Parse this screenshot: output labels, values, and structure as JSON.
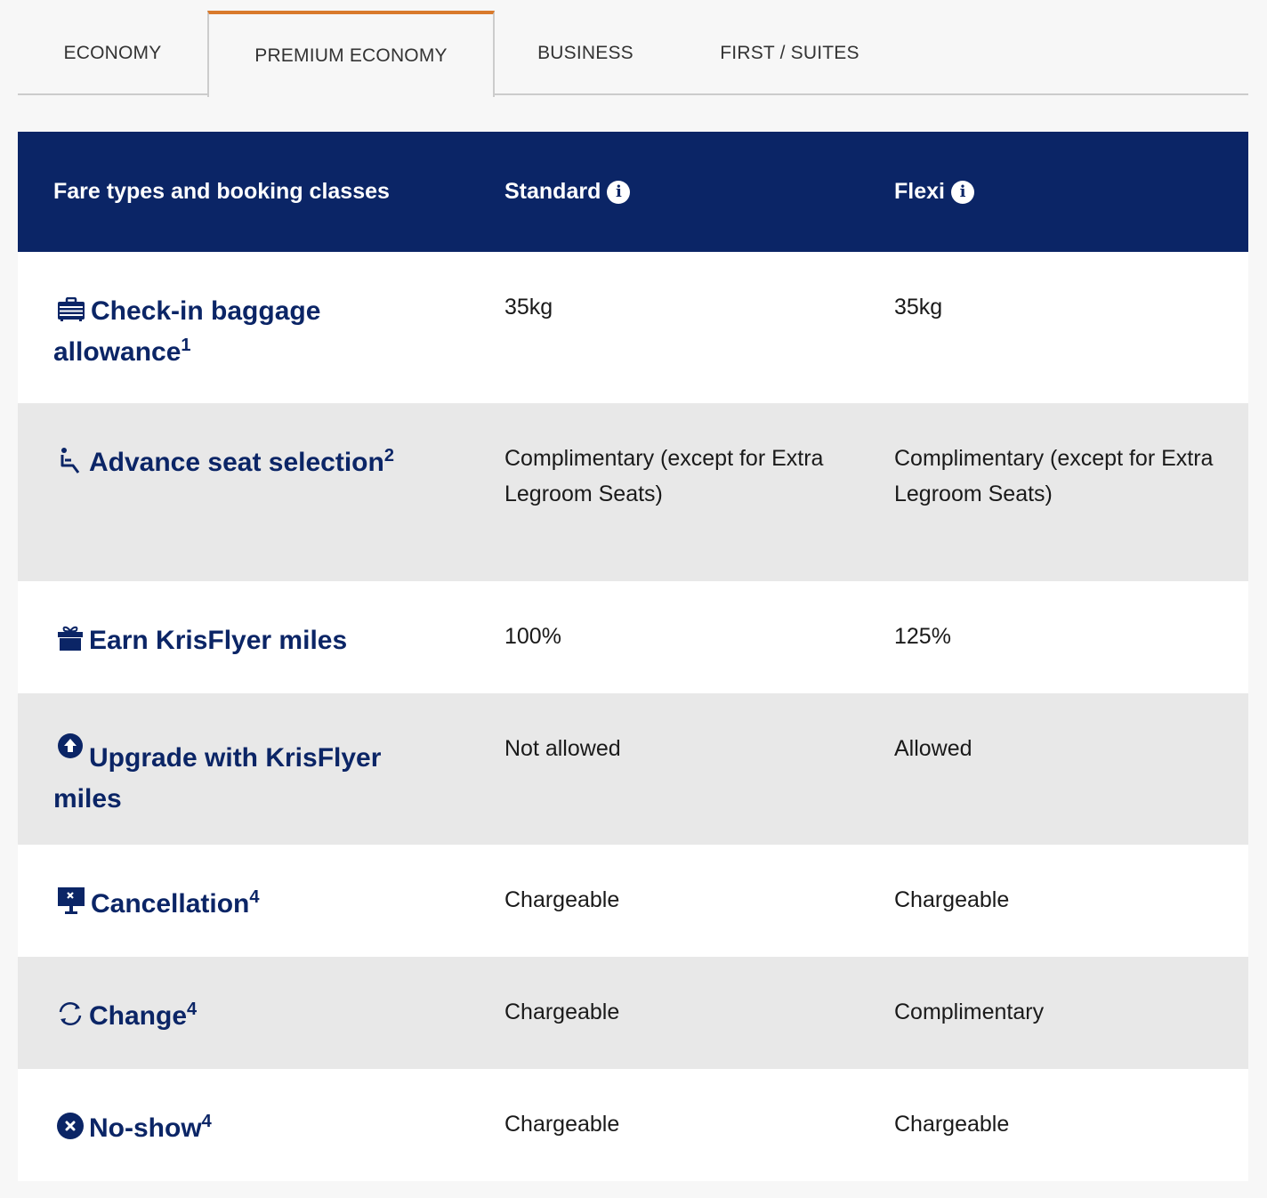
{
  "tabs": [
    {
      "label": "ECONOMY",
      "active": false
    },
    {
      "label": "PREMIUM ECONOMY",
      "active": true
    },
    {
      "label": "BUSINESS",
      "active": false
    },
    {
      "label": "FIRST / SUITES",
      "active": false
    }
  ],
  "table": {
    "header": {
      "label": "Fare types and booking classes",
      "col1": "Standard",
      "col2": "Flexi",
      "info_icon": "info-icon"
    },
    "rows": [
      {
        "icon": "suitcase-icon",
        "label": "Check-in baggage allowance",
        "sup": "1",
        "standard": "35kg",
        "flexi": "35kg"
      },
      {
        "icon": "seat-icon",
        "label": "Advance seat selection",
        "sup": "2",
        "standard": "Complimentary (except for Extra Legroom Seats)",
        "flexi": "Complimentary (except for Extra Legroom Seats)"
      },
      {
        "icon": "gift-icon",
        "label": "Earn KrisFlyer miles",
        "sup": "",
        "standard": "100%",
        "flexi": "125%"
      },
      {
        "icon": "upgrade-arrow-icon",
        "label": "Upgrade with KrisFlyer miles",
        "sup": "",
        "standard": "Not allowed",
        "flexi": "Allowed"
      },
      {
        "icon": "cancellation-icon",
        "label": "Cancellation",
        "sup": "4",
        "standard": "Chargeable",
        "flexi": "Chargeable"
      },
      {
        "icon": "change-icon",
        "label": "Change",
        "sup": "4",
        "standard": "Chargeable",
        "flexi": "Complimentary"
      },
      {
        "icon": "no-show-icon",
        "label": "No-show",
        "sup": "4",
        "standard": "Chargeable",
        "flexi": "Chargeable"
      }
    ]
  },
  "colors": {
    "navy": "#0b2566",
    "accent": "#d97a2c",
    "row_alt": "#e8e8e8"
  }
}
